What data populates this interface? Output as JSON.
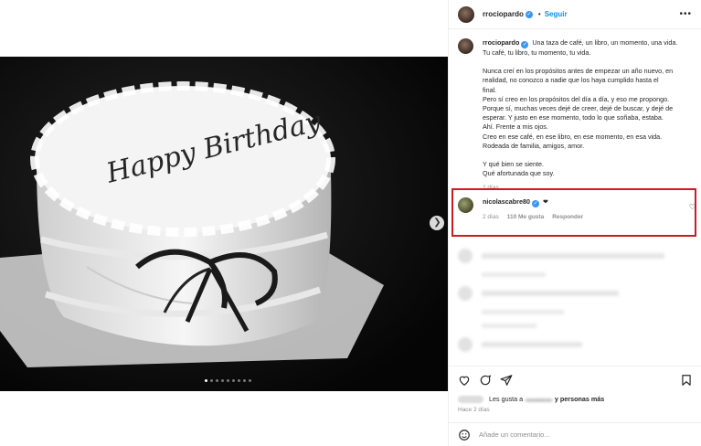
{
  "post": {
    "username": "rrociopardo",
    "follow_label": "Seguir",
    "separator": "•",
    "more_label": "•••",
    "caption_lines": [
      "Una taza de café, un libro, un momento, una vida.",
      "Tu café, tu libro, tu momento, tu vida.",
      "",
      "Nunca creí en los propósitos antes de empezar un año nuevo, en",
      "realidad, no conozco a nadie que los haya cumplido hasta el",
      "final.",
      "Pero sí creo en los propósitos del día a día, y eso me propongo.",
      "Porque sí, muchas veces dejé de creer, dejé de buscar, y dejé de",
      "esperar. Y justo en ese momento, todo lo que soñaba, estaba.",
      "Ahí. Frente a mis ojos.",
      "Creo en ese café, en ese libro, en ese momento, en esa vida.",
      "Rodeada de familia, amigos, amor.",
      "",
      "Y qué bien se siente.",
      "Qué afortunada que soy."
    ],
    "caption_time": "2 días",
    "image_text": "Happy Birthday",
    "carousel_count": 9,
    "carousel_active": 0
  },
  "highlight_comment": {
    "username": "nicolascabre80",
    "text": "❤",
    "time": "2 días",
    "likes": "110 Me gusta",
    "reply": "Responder"
  },
  "actions": {
    "likes_prefix": "Les gusta a",
    "likes_suffix": "y personas más",
    "time_ago": "Hace 2 días",
    "add_comment_placeholder": "Añade un comentario..."
  },
  "colors": {
    "accent": "#0095f6",
    "highlight_border": "#d11a20",
    "verified": "#3897f0"
  }
}
